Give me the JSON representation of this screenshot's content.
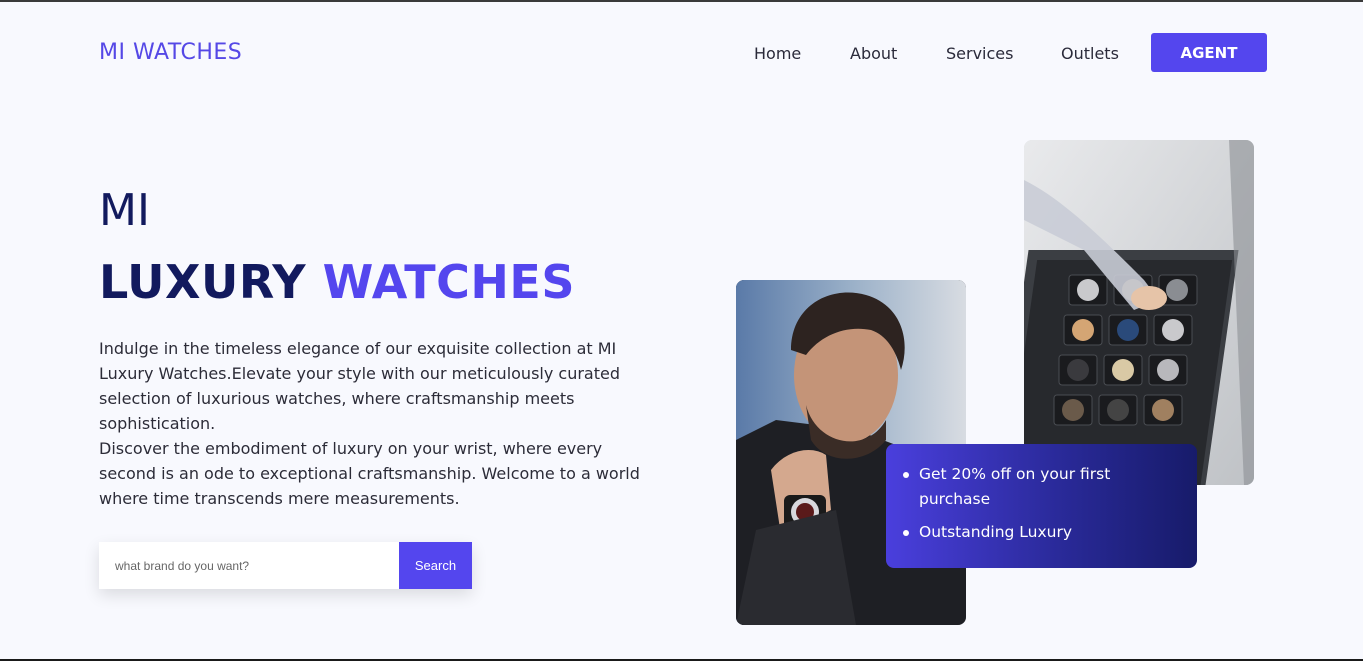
{
  "header": {
    "logo": "MI WATCHES",
    "nav": [
      "Home",
      "About",
      "Services",
      "Outlets"
    ],
    "agent_label": "AGENT"
  },
  "hero": {
    "pre_title": "MI",
    "title_dark": "LUXURY",
    "title_accent": "WATCHES",
    "paragraph_1": "Indulge in the timeless elegance of our exquisite collection at MI Luxury Watches.Elevate your style with our meticulously curated selection of luxurious watches, where craftsmanship meets sophistication.",
    "paragraph_2": "Discover the embodiment of luxury on your wrist, where every second is an ode to exceptional craftsmanship. Welcome to a world where time transcends mere measurements."
  },
  "search": {
    "placeholder": "what brand do you want?",
    "value": "",
    "button_label": "Search"
  },
  "promo": {
    "items": [
      "Get 20% off on your first purchase",
      "Outstanding Luxury"
    ]
  },
  "colors": {
    "accent": "#5446ee",
    "dark": "#121a5e",
    "background": "#f8f9fe"
  },
  "images": {
    "left": "man-adjusting-wristwatch",
    "right": "watch-display-case"
  }
}
